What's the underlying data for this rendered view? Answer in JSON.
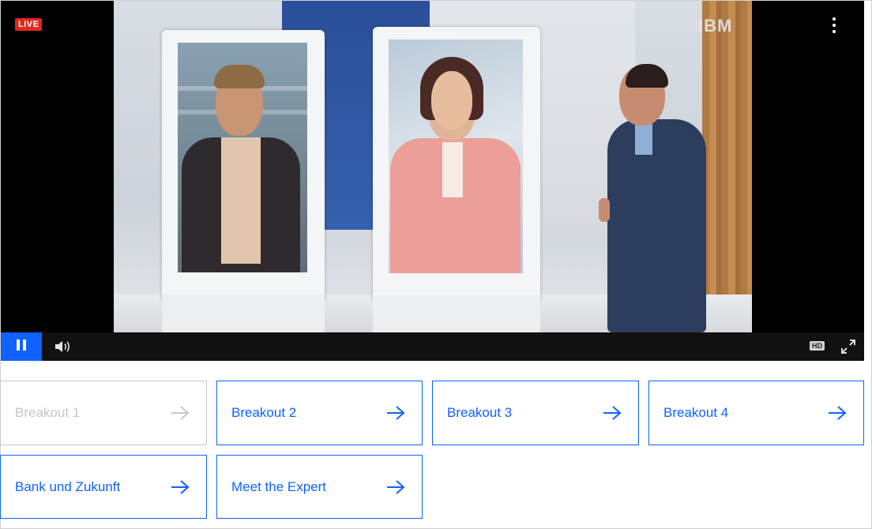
{
  "player": {
    "live_badge": "LIVE",
    "brand_logo": "IBM",
    "controls": {
      "hd_label": "HD",
      "pause_icon": "pause-icon",
      "volume_icon": "volume-icon",
      "fullscreen_icon": "fullscreen-icon",
      "menu_icon": "more-vertical-icon"
    }
  },
  "breakouts": [
    {
      "label": "Breakout 1",
      "enabled": false
    },
    {
      "label": "Breakout 2",
      "enabled": true
    },
    {
      "label": "Breakout 3",
      "enabled": true
    },
    {
      "label": "Breakout 4",
      "enabled": true
    },
    {
      "label": "Bank und Zukunft",
      "enabled": true
    },
    {
      "label": "Meet the Expert",
      "enabled": true
    }
  ],
  "colors": {
    "accent": "#0f62fe",
    "disabled": "#c6c6c6",
    "live": "#e0281c",
    "pause_button": "#1062fe"
  }
}
